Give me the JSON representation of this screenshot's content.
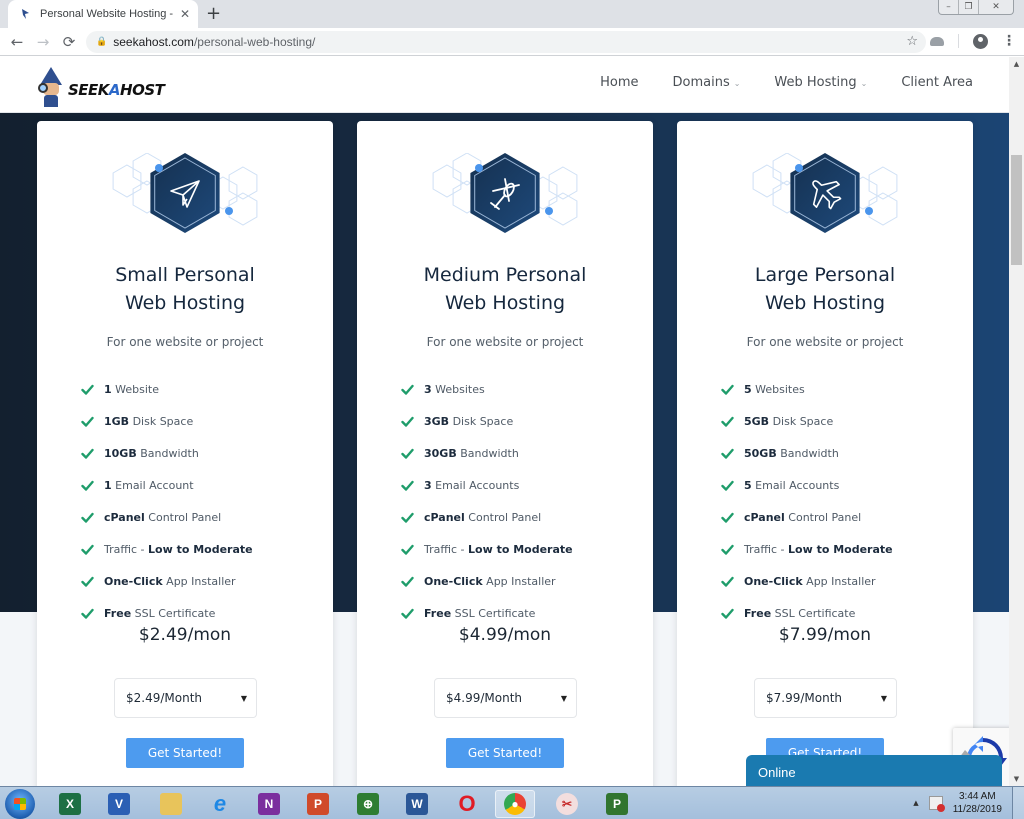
{
  "browser": {
    "tab_title": "Personal Website Hosting - Best",
    "tab_close": "✕",
    "new_tab": "+",
    "url_host": "seekahost.com",
    "url_path": "/personal-web-hosting/",
    "nav_back": "←",
    "nav_forward": "→",
    "nav_reload": "⟳",
    "star": "☆",
    "menu": "⋮",
    "win_minimize": "–",
    "win_restore": "❐",
    "win_close": "✕"
  },
  "site": {
    "logo": {
      "text_before": "SEEK",
      "text_accent": "A",
      "text_after": "HOST"
    },
    "nav": [
      {
        "label": "Home",
        "dropdown": false
      },
      {
        "label": "Domains",
        "dropdown": true
      },
      {
        "label": "Web Hosting",
        "dropdown": true
      },
      {
        "label": "Client Area",
        "dropdown": false
      }
    ],
    "caret": "⌄"
  },
  "colors": {
    "hero_left": "#13202f",
    "hero_right": "#1b4574",
    "page_bg": "#f3f6f9",
    "title": "#16283e",
    "check": "#1f9d6b",
    "button": "#4d9bef",
    "icon_hex": "#1b3d66",
    "dot": "#4a95ec",
    "chat": "#1a7ab0"
  },
  "plans": [
    {
      "icon": "paper-plane-icon",
      "title_line1": "Small Personal",
      "title_line2": "Web Hosting",
      "subtitle": "For one website or project",
      "features": [
        {
          "bold": "1",
          "text": " Website"
        },
        {
          "bold": "1GB",
          "text": " Disk Space"
        },
        {
          "bold": "10GB",
          "text": " Bandwidth"
        },
        {
          "bold": "1",
          "text": " Email Account"
        },
        {
          "bold": "cPanel",
          "text": " Control Panel"
        },
        {
          "pre": "Traffic - ",
          "bold": "Low to Moderate",
          "text": ""
        },
        {
          "bold": "One-Click",
          "text": " App Installer"
        },
        {
          "bold": "Free",
          "text": " SSL Certificate"
        }
      ],
      "price": "$2.49/mon",
      "select_value": "$2.49/Month",
      "button": "Get Started!"
    },
    {
      "icon": "helicopter-icon",
      "title_line1": "Medium Personal",
      "title_line2": "Web Hosting",
      "subtitle": "For one website or project",
      "features": [
        {
          "bold": "3",
          "text": " Websites"
        },
        {
          "bold": "3GB",
          "text": " Disk Space"
        },
        {
          "bold": "30GB",
          "text": " Bandwidth"
        },
        {
          "bold": "3",
          "text": " Email Accounts"
        },
        {
          "bold": "cPanel",
          "text": " Control Panel"
        },
        {
          "pre": "Traffic - ",
          "bold": "Low to Moderate",
          "text": ""
        },
        {
          "bold": "One-Click",
          "text": " App Installer"
        },
        {
          "bold": "Free",
          "text": " SSL Certificate"
        }
      ],
      "price": "$4.99/mon",
      "select_value": "$4.99/Month",
      "button": "Get Started!"
    },
    {
      "icon": "airplane-icon",
      "title_line1": "Large Personal",
      "title_line2": "Web Hosting",
      "subtitle": "For one website or project",
      "features": [
        {
          "bold": "5",
          "text": " Websites"
        },
        {
          "bold": "5GB",
          "text": " Disk Space"
        },
        {
          "bold": "50GB",
          "text": " Bandwidth"
        },
        {
          "bold": "5",
          "text": " Email Accounts"
        },
        {
          "bold": "cPanel",
          "text": " Control Panel"
        },
        {
          "pre": "Traffic - ",
          "bold": "Low to Moderate",
          "text": ""
        },
        {
          "bold": "One-Click",
          "text": " App Installer"
        },
        {
          "bold": "Free",
          "text": " SSL Certificate"
        }
      ],
      "price": "$7.99/mon",
      "select_value": "$7.99/Month",
      "button": "Get Started!"
    }
  ],
  "chat_widget": {
    "label": "Online"
  },
  "taskbar": {
    "apps": [
      {
        "name": "excel",
        "glyph": "X",
        "color": "#1d7044"
      },
      {
        "name": "visio",
        "glyph": "V",
        "color": "#2b5fb4"
      },
      {
        "name": "file-explorer",
        "glyph": "",
        "color": "#e8c45b"
      },
      {
        "name": "internet-explorer",
        "glyph": "e",
        "color": "#1e88e5"
      },
      {
        "name": "onenote",
        "glyph": "N",
        "color": "#7b2f9e"
      },
      {
        "name": "powerpoint",
        "glyph": "P",
        "color": "#d04a2a"
      },
      {
        "name": "project-web",
        "glyph": "⊕",
        "color": "#2e7d32"
      },
      {
        "name": "word",
        "glyph": "W",
        "color": "#2b5797"
      },
      {
        "name": "opera",
        "glyph": "O",
        "color": "#e01b24"
      },
      {
        "name": "chrome",
        "glyph": "●",
        "color": "#fbbc04"
      },
      {
        "name": "snipping-tool",
        "glyph": "✂",
        "color": "#d9534f"
      },
      {
        "name": "project",
        "glyph": "P",
        "color": "#31752f"
      }
    ],
    "tray_arrow": "▲",
    "time": "3:44 AM",
    "date": "11/28/2019"
  },
  "scrollbar": {
    "up": "▲",
    "down": "▼"
  }
}
